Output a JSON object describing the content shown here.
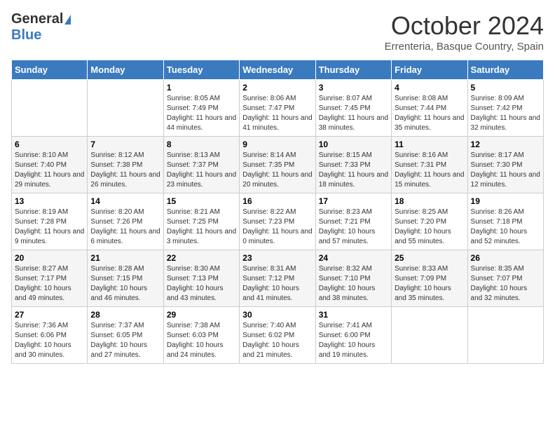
{
  "logo": {
    "general": "General",
    "blue": "Blue"
  },
  "title": "October 2024",
  "subtitle": "Errenteria, Basque Country, Spain",
  "days": [
    "Sunday",
    "Monday",
    "Tuesday",
    "Wednesday",
    "Thursday",
    "Friday",
    "Saturday"
  ],
  "weeks": [
    [
      {
        "date": "",
        "info": ""
      },
      {
        "date": "",
        "info": ""
      },
      {
        "date": "1",
        "info": "Sunrise: 8:05 AM\nSunset: 7:49 PM\nDaylight: 11 hours and 44 minutes."
      },
      {
        "date": "2",
        "info": "Sunrise: 8:06 AM\nSunset: 7:47 PM\nDaylight: 11 hours and 41 minutes."
      },
      {
        "date": "3",
        "info": "Sunrise: 8:07 AM\nSunset: 7:45 PM\nDaylight: 11 hours and 38 minutes."
      },
      {
        "date": "4",
        "info": "Sunrise: 8:08 AM\nSunset: 7:44 PM\nDaylight: 11 hours and 35 minutes."
      },
      {
        "date": "5",
        "info": "Sunrise: 8:09 AM\nSunset: 7:42 PM\nDaylight: 11 hours and 32 minutes."
      }
    ],
    [
      {
        "date": "6",
        "info": "Sunrise: 8:10 AM\nSunset: 7:40 PM\nDaylight: 11 hours and 29 minutes."
      },
      {
        "date": "7",
        "info": "Sunrise: 8:12 AM\nSunset: 7:38 PM\nDaylight: 11 hours and 26 minutes."
      },
      {
        "date": "8",
        "info": "Sunrise: 8:13 AM\nSunset: 7:37 PM\nDaylight: 11 hours and 23 minutes."
      },
      {
        "date": "9",
        "info": "Sunrise: 8:14 AM\nSunset: 7:35 PM\nDaylight: 11 hours and 20 minutes."
      },
      {
        "date": "10",
        "info": "Sunrise: 8:15 AM\nSunset: 7:33 PM\nDaylight: 11 hours and 18 minutes."
      },
      {
        "date": "11",
        "info": "Sunrise: 8:16 AM\nSunset: 7:31 PM\nDaylight: 11 hours and 15 minutes."
      },
      {
        "date": "12",
        "info": "Sunrise: 8:17 AM\nSunset: 7:30 PM\nDaylight: 11 hours and 12 minutes."
      }
    ],
    [
      {
        "date": "13",
        "info": "Sunrise: 8:19 AM\nSunset: 7:28 PM\nDaylight: 11 hours and 9 minutes."
      },
      {
        "date": "14",
        "info": "Sunrise: 8:20 AM\nSunset: 7:26 PM\nDaylight: 11 hours and 6 minutes."
      },
      {
        "date": "15",
        "info": "Sunrise: 8:21 AM\nSunset: 7:25 PM\nDaylight: 11 hours and 3 minutes."
      },
      {
        "date": "16",
        "info": "Sunrise: 8:22 AM\nSunset: 7:23 PM\nDaylight: 11 hours and 0 minutes."
      },
      {
        "date": "17",
        "info": "Sunrise: 8:23 AM\nSunset: 7:21 PM\nDaylight: 10 hours and 57 minutes."
      },
      {
        "date": "18",
        "info": "Sunrise: 8:25 AM\nSunset: 7:20 PM\nDaylight: 10 hours and 55 minutes."
      },
      {
        "date": "19",
        "info": "Sunrise: 8:26 AM\nSunset: 7:18 PM\nDaylight: 10 hours and 52 minutes."
      }
    ],
    [
      {
        "date": "20",
        "info": "Sunrise: 8:27 AM\nSunset: 7:17 PM\nDaylight: 10 hours and 49 minutes."
      },
      {
        "date": "21",
        "info": "Sunrise: 8:28 AM\nSunset: 7:15 PM\nDaylight: 10 hours and 46 minutes."
      },
      {
        "date": "22",
        "info": "Sunrise: 8:30 AM\nSunset: 7:13 PM\nDaylight: 10 hours and 43 minutes."
      },
      {
        "date": "23",
        "info": "Sunrise: 8:31 AM\nSunset: 7:12 PM\nDaylight: 10 hours and 41 minutes."
      },
      {
        "date": "24",
        "info": "Sunrise: 8:32 AM\nSunset: 7:10 PM\nDaylight: 10 hours and 38 minutes."
      },
      {
        "date": "25",
        "info": "Sunrise: 8:33 AM\nSunset: 7:09 PM\nDaylight: 10 hours and 35 minutes."
      },
      {
        "date": "26",
        "info": "Sunrise: 8:35 AM\nSunset: 7:07 PM\nDaylight: 10 hours and 32 minutes."
      }
    ],
    [
      {
        "date": "27",
        "info": "Sunrise: 7:36 AM\nSunset: 6:06 PM\nDaylight: 10 hours and 30 minutes."
      },
      {
        "date": "28",
        "info": "Sunrise: 7:37 AM\nSunset: 6:05 PM\nDaylight: 10 hours and 27 minutes."
      },
      {
        "date": "29",
        "info": "Sunrise: 7:38 AM\nSunset: 6:03 PM\nDaylight: 10 hours and 24 minutes."
      },
      {
        "date": "30",
        "info": "Sunrise: 7:40 AM\nSunset: 6:02 PM\nDaylight: 10 hours and 21 minutes."
      },
      {
        "date": "31",
        "info": "Sunrise: 7:41 AM\nSunset: 6:00 PM\nDaylight: 10 hours and 19 minutes."
      },
      {
        "date": "",
        "info": ""
      },
      {
        "date": "",
        "info": ""
      }
    ]
  ]
}
